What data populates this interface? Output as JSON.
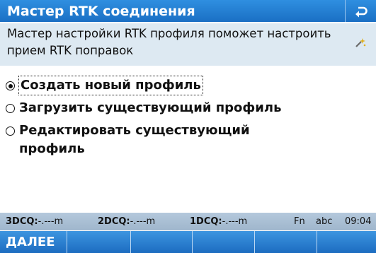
{
  "titlebar": {
    "title": "Мастер RTK соединения",
    "back_icon": "return-arrow-icon"
  },
  "description": {
    "text": "Мастер настройки RTK профиля поможет настроить прием RTK поправок",
    "icon": "wizard-wand-icon"
  },
  "options": [
    {
      "label": "Создать новый профиль",
      "checked": true
    },
    {
      "label": "Загрузить существующий профиль",
      "checked": false
    },
    {
      "label": "Редактировать существующий профиль",
      "checked": false
    }
  ],
  "status": {
    "q3_label": "3DCQ:",
    "q3_value": "-.---m",
    "q2_label": "2DCQ:",
    "q2_value": "-.---m",
    "q1_label": "1DCQ:",
    "q1_value": "-.---m",
    "fn": "Fn",
    "input_mode": "abc",
    "time": "09:04"
  },
  "softkeys": {
    "f1": "ДАЛЕЕ",
    "f2": "",
    "f3": "",
    "f4": "",
    "f5": "",
    "f6": ""
  },
  "colors": {
    "title_bar": "#1a6fc4",
    "desc_bg": "#dde9f2",
    "status_bg": "#a9bfd4"
  }
}
